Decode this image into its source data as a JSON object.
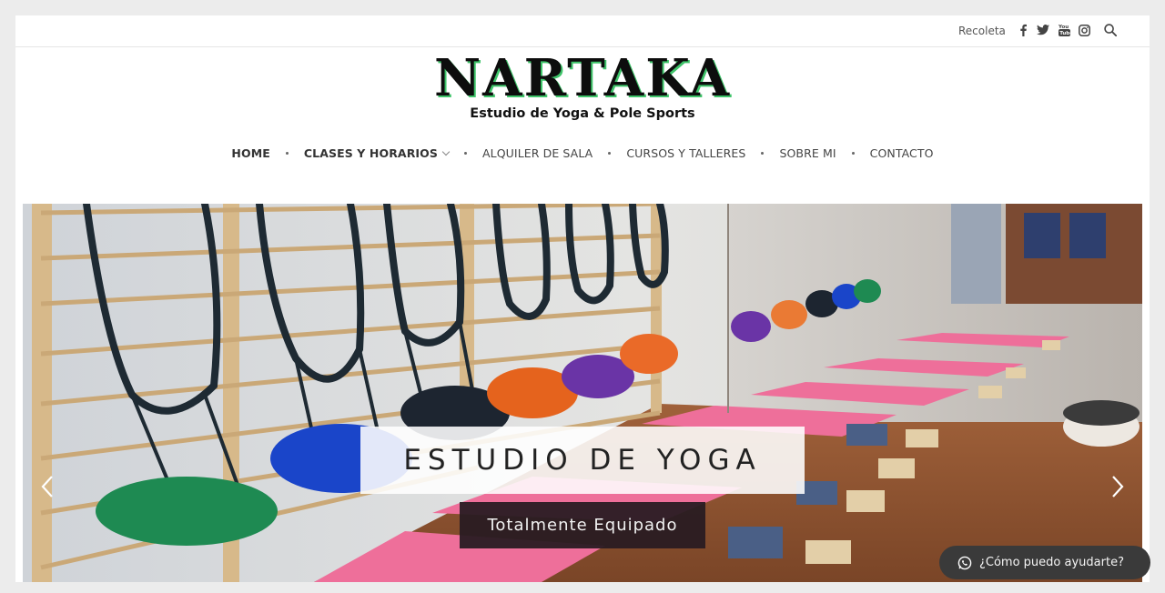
{
  "topbar": {
    "location": "Recoleta",
    "icons": [
      "facebook-icon",
      "twitter-icon",
      "youtube-icon",
      "instagram-icon",
      "search-icon"
    ]
  },
  "logo": {
    "brand": "NARTAKA",
    "tagline": "Estudio de Yoga & Pole Sports"
  },
  "nav": {
    "items": [
      {
        "label": "HOME"
      },
      {
        "label": "CLASES Y HORARIOS"
      },
      {
        "label": "ALQUILER DE SALA"
      },
      {
        "label": "CURSOS Y TALLERES"
      },
      {
        "label": "SOBRE MI"
      },
      {
        "label": "CONTACTO"
      }
    ]
  },
  "hero": {
    "title": "ESTUDIO DE YOGA",
    "subtitle": "Totalmente Equipado"
  },
  "chat": {
    "label": "¿Cómo puedo ayudarte?"
  },
  "colors": {
    "logo_shadow": "#3fc46a",
    "chat_bg": "#3a3a3a",
    "caption_dark": "#281c22"
  }
}
